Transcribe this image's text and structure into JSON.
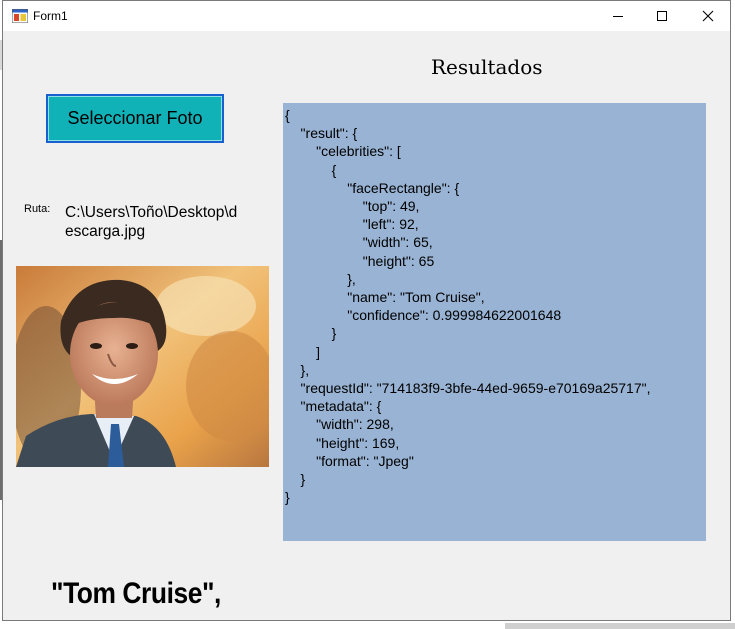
{
  "window": {
    "title": "Form1",
    "controls": [
      "minimize",
      "maximize",
      "close"
    ]
  },
  "main": {
    "results_heading": "Resultados",
    "select_button_label": "Seleccionar Foto",
    "path_label": "Ruta:",
    "path_value": "C:\\Users\\Toño\\Desktop\\descarga.jpg",
    "photo_alt": "Tom Cruise",
    "detected_name": "\"Tom Cruise\","
  },
  "result_json_lines": [
    "{",
    "    \"result\": {",
    "        \"celebrities\": [",
    "            {",
    "                \"faceRectangle\": {",
    "                    \"top\": 49,",
    "                    \"left\": 92,",
    "                    \"width\": 65,",
    "                    \"height\": 65",
    "                },",
    "                \"name\": \"Tom Cruise\",",
    "                \"confidence\": 0.999984622001648",
    "            }",
    "        ]",
    "    },",
    "    \"requestId\": \"714183f9-3bfe-44ed-9659-e70169a25717\",",
    "    \"metadata\": {",
    "        \"width\": 298,",
    "        \"height\": 169,",
    "        \"format\": \"Jpeg\"",
    "    }",
    "}"
  ],
  "colors": {
    "button_bg": "#10b2b8",
    "button_border": "#1a5fd0",
    "result_bg": "#98b3d3",
    "form_bg": "#f0f0f0"
  }
}
